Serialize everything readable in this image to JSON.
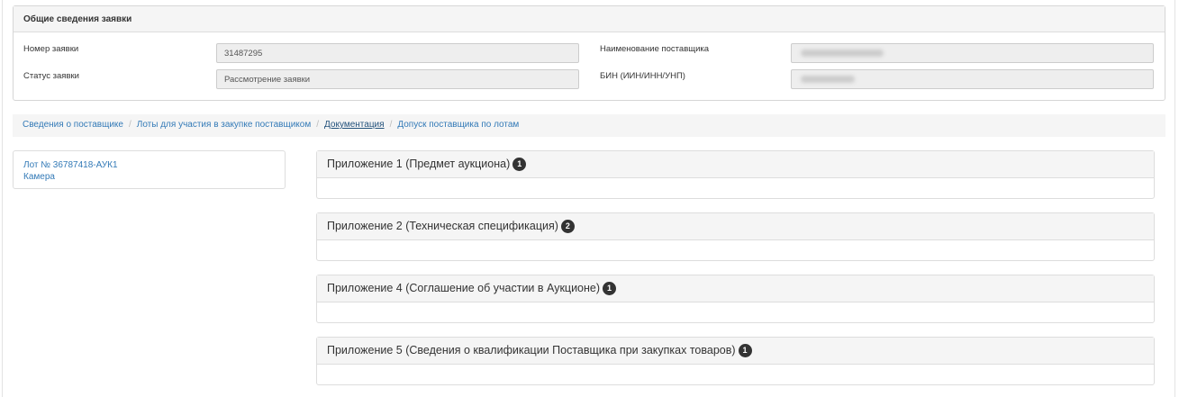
{
  "info_panel": {
    "title": "Общие сведения заявки",
    "application_number_label": "Номер заявки",
    "application_number_value": "31487295",
    "application_status_label": "Статус заявки",
    "application_status_value": "Рассмотрение заявки",
    "supplier_name_label": "Наименование поставщика",
    "bin_label": "БИН (ИИН/ИНН/УНП)"
  },
  "breadcrumb": {
    "items": [
      "Сведения о поставщике",
      "Лоты для участия в закупке поставщиком",
      "Документация",
      "Допуск поставщика по лотам"
    ],
    "separator": "/"
  },
  "lot": {
    "number": "Лот № 36787418-АУК1",
    "name": "Камера"
  },
  "documents": [
    {
      "title": "Приложение 1 (Предмет аукциона)",
      "count": "1"
    },
    {
      "title": "Приложение 2 (Техническая спецификация)",
      "count": "2"
    },
    {
      "title": "Приложение 4 (Соглашение об участии в Аукционе)",
      "count": "1"
    },
    {
      "title": "Приложение 5 (Сведения о квалификации Поставщика при закупках товаров)",
      "count": "1"
    }
  ]
}
